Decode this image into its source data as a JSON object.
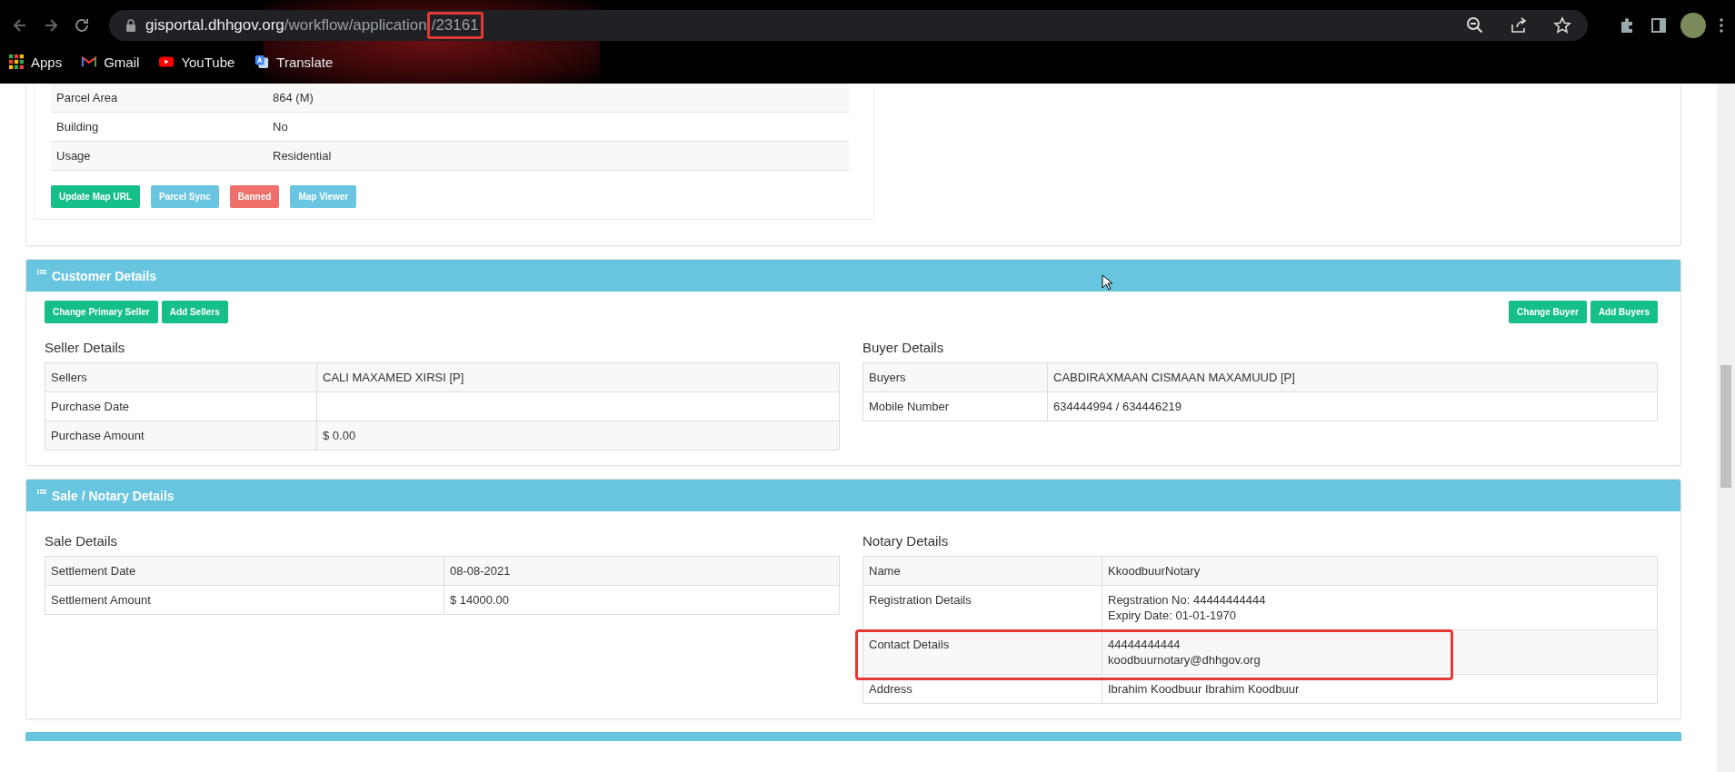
{
  "browser": {
    "url_host": "gisportal.dhhgov.org",
    "url_path": "/workflow/application",
    "url_marked": "/23161",
    "bookmarks": [
      {
        "label": "Apps",
        "kind": "apps"
      },
      {
        "label": "Gmail",
        "kind": "gmail"
      },
      {
        "label": "YouTube",
        "kind": "youtube"
      },
      {
        "label": "Translate",
        "kind": "translate"
      }
    ]
  },
  "property": {
    "rows": [
      {
        "label": "Parcel Area",
        "value": "864 (M)"
      },
      {
        "label": "Building",
        "value": "No"
      },
      {
        "label": "Usage",
        "value": "Residential"
      }
    ],
    "buttons": [
      {
        "label": "Update Map URL",
        "kind": "success"
      },
      {
        "label": "Parcel Sync",
        "kind": "info"
      },
      {
        "label": "Banned",
        "kind": "danger"
      },
      {
        "label": "Map Viewer",
        "kind": "info"
      }
    ]
  },
  "customer": {
    "title": "Customer Details",
    "seller_buttons": [
      "Change Primary Seller",
      "Add Sellers"
    ],
    "buyer_buttons": [
      "Change Buyer",
      "Add Buyers"
    ],
    "seller": {
      "title": "Seller Details",
      "rows": [
        {
          "label": "Sellers",
          "values": [
            "CALI MAXAMED XIRSI [P]"
          ]
        },
        {
          "label": "Purchase Date",
          "values": []
        },
        {
          "label": "Purchase Amount",
          "values": [
            "$ 0.00"
          ]
        }
      ]
    },
    "buyer": {
      "title": "Buyer Details",
      "rows": [
        {
          "label": "Buyers",
          "values": [
            "CABDIRAXMAAN CISMAAN MAXAMUUD [P]"
          ]
        },
        {
          "label": "Mobile Number",
          "values": [
            "634444994 / 634446219"
          ]
        }
      ]
    }
  },
  "sale": {
    "title": "Sale / Notary Details",
    "sale": {
      "title": "Sale Details",
      "rows": [
        {
          "label": "Settlement Date",
          "values": [
            "08-08-2021"
          ]
        },
        {
          "label": "Settlement Amount",
          "values": [
            "$ 14000.00"
          ]
        }
      ]
    },
    "notary": {
      "title": "Notary Details",
      "rows": [
        {
          "label": "Name",
          "values": [
            "KkoodbuurNotary"
          ],
          "highlighted": false
        },
        {
          "label": "Registration Details",
          "values": [
            "Regstration No: 44444444444",
            "Expiry Date: 01-01-1970"
          ],
          "highlighted": false
        },
        {
          "label": "Contact Details",
          "values": [
            "44444444444",
            "koodbuurnotary@dhhgov.org"
          ],
          "highlighted": true
        },
        {
          "label": "Address",
          "values": [
            "Ibrahim Koodbuur Ibrahim Koodbuur"
          ],
          "highlighted": false
        }
      ]
    }
  }
}
